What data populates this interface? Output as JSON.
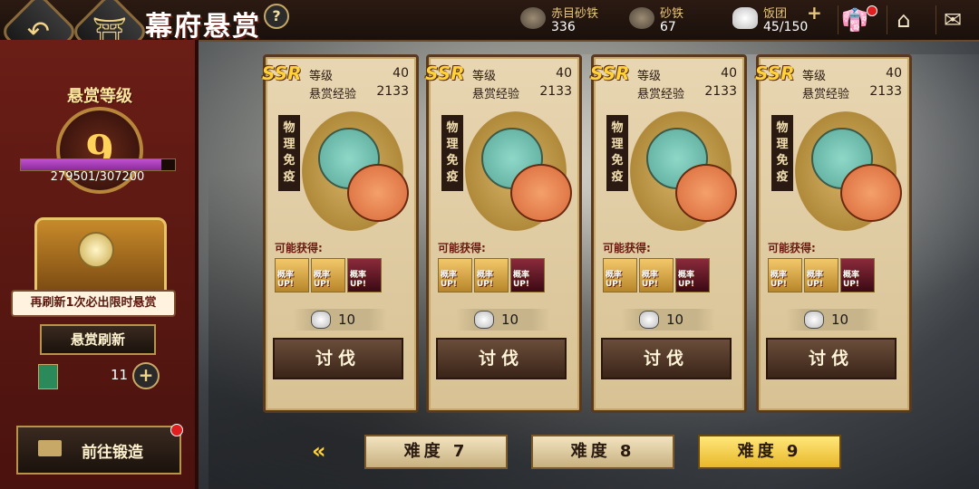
{
  "header": {
    "title": "幕府悬赏",
    "back_icon": "back-arrow-icon",
    "home_icon": "castle-icon",
    "help_label": "?"
  },
  "resources": [
    {
      "label": "赤目砂铁",
      "value": "336"
    },
    {
      "label": "砂铁",
      "value": "67"
    },
    {
      "label": "饭团",
      "value": "45/150"
    }
  ],
  "resource_plus": "+",
  "bounty": {
    "level_label": "悬赏等级",
    "level": "9",
    "exp_text": "279501/307200",
    "exp_progress": 0.91,
    "hint": "再刷新1次必出限时悬赏",
    "refresh_label": "悬赏刷新",
    "tickets": "11",
    "plus_label": "+",
    "forge_label": "前往锻造"
  },
  "cards": [
    {
      "rarity": "SSR",
      "grade_label": "等级",
      "grade": "40",
      "exp_label": "悬赏经验",
      "exp": "2133",
      "tag": "物理免疫",
      "loot_label": "可能获得:",
      "loot": [
        "概率UP!",
        "概率UP!",
        "概率UP!"
      ],
      "cost": "10",
      "button": "讨伐"
    },
    {
      "rarity": "SSR",
      "grade_label": "等级",
      "grade": "40",
      "exp_label": "悬赏经验",
      "exp": "2133",
      "tag": "物理免疫",
      "loot_label": "可能获得:",
      "loot": [
        "概率UP!",
        "概率UP!",
        "概率UP!"
      ],
      "cost": "10",
      "button": "讨伐"
    },
    {
      "rarity": "SSR",
      "grade_label": "等级",
      "grade": "40",
      "exp_label": "悬赏经验",
      "exp": "2133",
      "tag": "物理免疫",
      "loot_label": "可能获得:",
      "loot": [
        "概率UP!",
        "概率UP!",
        "概率UP!"
      ],
      "cost": "10",
      "button": "讨伐"
    },
    {
      "rarity": "SSR",
      "grade_label": "等级",
      "grade": "40",
      "exp_label": "悬赏经验",
      "exp": "2133",
      "tag": "物理免疫",
      "loot_label": "可能获得:",
      "loot": [
        "概率UP!",
        "概率UP!",
        "概率UP!"
      ],
      "cost": "10",
      "button": "讨伐"
    }
  ],
  "difficulty": {
    "arrows": "«",
    "options": [
      "难度 7",
      "难度 8",
      "难度 9"
    ],
    "selected": "难度 9"
  },
  "top_icons": [
    "wardrobe-icon",
    "home-icon",
    "mail-icon"
  ],
  "colors": {
    "accent": "#ffd23a",
    "panel": "#6a1e16",
    "card": "#e8d6b2"
  }
}
